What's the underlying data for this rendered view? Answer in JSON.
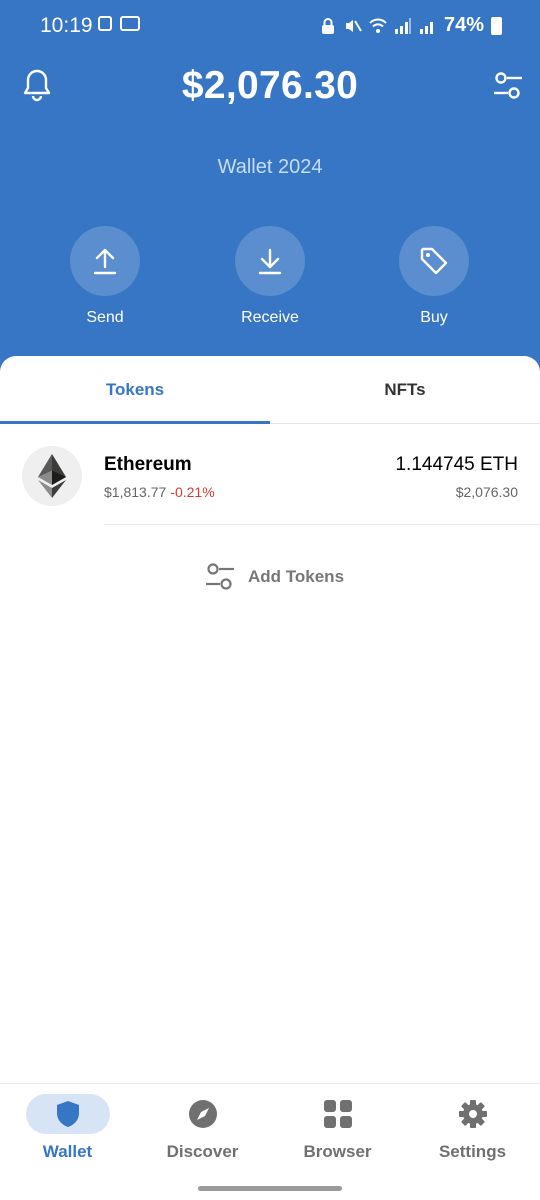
{
  "status_bar": {
    "time": "10:19",
    "battery": "74%"
  },
  "header": {
    "balance": "$2,076.30",
    "wallet_name": "Wallet 2024",
    "background_color": "#3676c4"
  },
  "actions": [
    {
      "label": "Send",
      "icon": "arrow-up-icon"
    },
    {
      "label": "Receive",
      "icon": "arrow-down-icon"
    },
    {
      "label": "Buy",
      "icon": "tag-icon"
    }
  ],
  "tabs": [
    {
      "label": "Tokens",
      "active": true
    },
    {
      "label": "NFTs",
      "active": false
    }
  ],
  "tokens": [
    {
      "name": "Ethereum",
      "price": "$1,813.77",
      "change": "-0.21%",
      "amount": "1.144745 ETH",
      "value": "$2,076.30",
      "icon": "ethereum-logo-icon"
    }
  ],
  "add_tokens_label": "Add Tokens",
  "nav": [
    {
      "label": "Wallet",
      "icon": "shield-icon",
      "active": true
    },
    {
      "label": "Discover",
      "icon": "compass-icon",
      "active": false
    },
    {
      "label": "Browser",
      "icon": "grid-icon",
      "active": false
    },
    {
      "label": "Settings",
      "icon": "gear-icon",
      "active": false
    }
  ],
  "colors": {
    "accent": "#3676c4",
    "negative": "#d23a3a"
  }
}
